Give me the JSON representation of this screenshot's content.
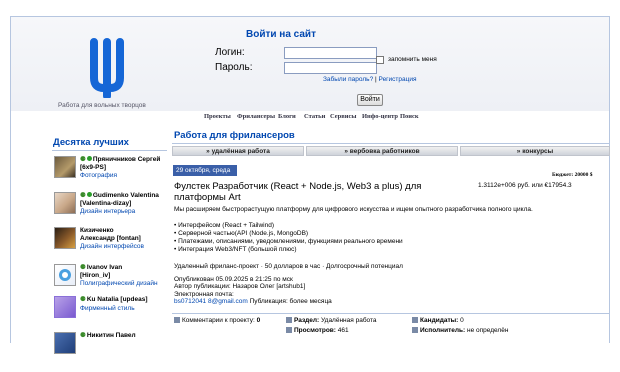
{
  "header": {
    "tagline": "Работа для вольных творцов",
    "login_title": "Войти на сайт",
    "login_label": "Логин:",
    "password_label": "Пароль:",
    "remember_label": "запомнить меня",
    "forgot_link": "Забыли пароль?",
    "separator": "|",
    "register_link": "Регистрация",
    "login_button": "Войти",
    "logo_color": "#1566d6"
  },
  "nav": [
    "Проекты",
    "Фрилансеры",
    "Блоги",
    "Статьи",
    "Сервисы",
    "Инфо-центр",
    "Поиск"
  ],
  "section_title": "Работа для фрилансеров",
  "tabs": [
    "» удалённая работа",
    "» вербовка работников",
    "» конкурсы"
  ],
  "sidebar": {
    "title": "Десятка лучших",
    "users": [
      {
        "name": "Пряничников Сергей",
        "login": "[6x9-PS]",
        "spec": "Фотография"
      },
      {
        "name": "Gudimenko Valentina",
        "login": "[Valentina-dizay]",
        "spec": "Дизайн интерьера"
      },
      {
        "name": "Кизиченко",
        "login": "Александр [fontan]",
        "spec": "Дизайн интерфейсов"
      },
      {
        "name": "Ivanov Ivan",
        "login": "[Hiron_iv]",
        "spec": "Полиграфический дизайн"
      },
      {
        "name": "Ku Natalia [updeas]",
        "login": "",
        "spec": "Фирменный стиль"
      },
      {
        "name": "Никитин Павел",
        "login": "",
        "spec": ""
      }
    ]
  },
  "job": {
    "date": "29 октября, среда",
    "budget_label": "Бюджет: 20000 $",
    "budget_value": "1.3112e+006 руб. или €17954.3",
    "title": "Фулстек Разработчик (React + Node.js, Web3 a plus) для платформы Art",
    "description": [
      "Мы расширяем быстрорастущую платформу для цифрового искусства и ищем опытного разработчика полного цикла.",
      "",
      "• Интерфейсом (React + Tailwind)",
      "• Серверной частью(API (Node.js, MongoDB)",
      "• Платежами, описаниями, уведомлениями, функциями реального времени",
      "• Интеграция Web3/NFT (большой плюс)",
      "",
      "Удаленный фриланс-проект · 50 долларов в час · Долгосрочный потенциал"
    ],
    "published": "Опубликован 05.09.2025 в 21:25 по мск",
    "author": "Автор публикации: Назаров Олег [artshub1]",
    "email_label": "Электронная почта:",
    "email": "bs0712041 8@gmail.com",
    "email_note": "Публикация: более месяца"
  },
  "footer": {
    "comments_label": "Комментарии к проекту:",
    "comments_value": "0",
    "section_label": "Раздел:",
    "section_value": "Удалённая работа",
    "views_label": "Просмотров:",
    "views_value": "461",
    "candidates_label": "Кандидаты:",
    "candidates_value": "0",
    "executor_label": "Исполнитель:",
    "executor_value": "не определён"
  }
}
